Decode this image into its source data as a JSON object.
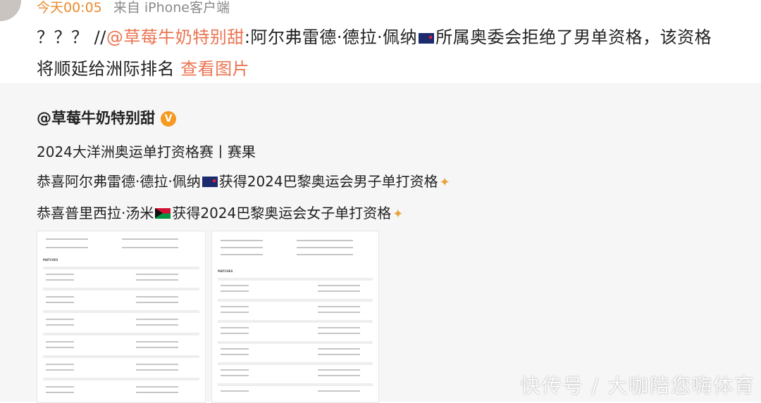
{
  "post": {
    "time": "今天00:05",
    "source": "来自 iPhone客户端",
    "line1_prefix": "？？？ //",
    "mention": "@草莓牛奶特别甜",
    "line1_rest_a": ":阿尔弗雷德·德拉·佩纳",
    "line1_rest_b": "所属奥委会拒绝了男单资格，该资格",
    "line2": "将顺延给洲际排名",
    "view_image": "查看图片"
  },
  "repost": {
    "author": "@草莓牛奶特别甜",
    "verified_badge": "V",
    "line1": "2024大洋洲奥运单打资格赛丨赛果",
    "line2_a": "恭喜阿尔弗雷德·德拉·佩纳",
    "line2_b": "获得2024巴黎奥运会男子单打资格",
    "line3_a": "恭喜普里西拉·汤米",
    "line3_b": "获得2024巴黎奥运会女子单打资格",
    "images": {
      "left_header": "MATCHES",
      "right_header": "MATCHES"
    }
  },
  "watermark": "快传号 / 大咖陪您嗨体育",
  "colors": {
    "link": "#eb7350",
    "time": "#e98a2a",
    "repost_bg": "#f6f6f6",
    "badge": "#f59a21"
  }
}
